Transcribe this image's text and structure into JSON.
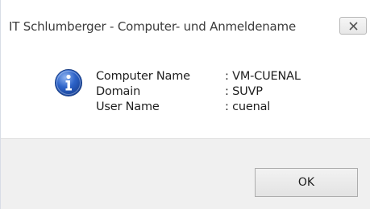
{
  "window": {
    "title": "IT Schlumberger - Computer- und Anmeldename"
  },
  "icon": {
    "type": "information-icon",
    "color": "#2d63c8"
  },
  "details": [
    {
      "label": "Computer Name",
      "value": ": VM-CUENAL"
    },
    {
      "label": "Domain",
      "value": ": SUVP"
    },
    {
      "label": "User Name",
      "value": ": cuenal"
    }
  ],
  "buttons": {
    "ok_label": "OK"
  }
}
